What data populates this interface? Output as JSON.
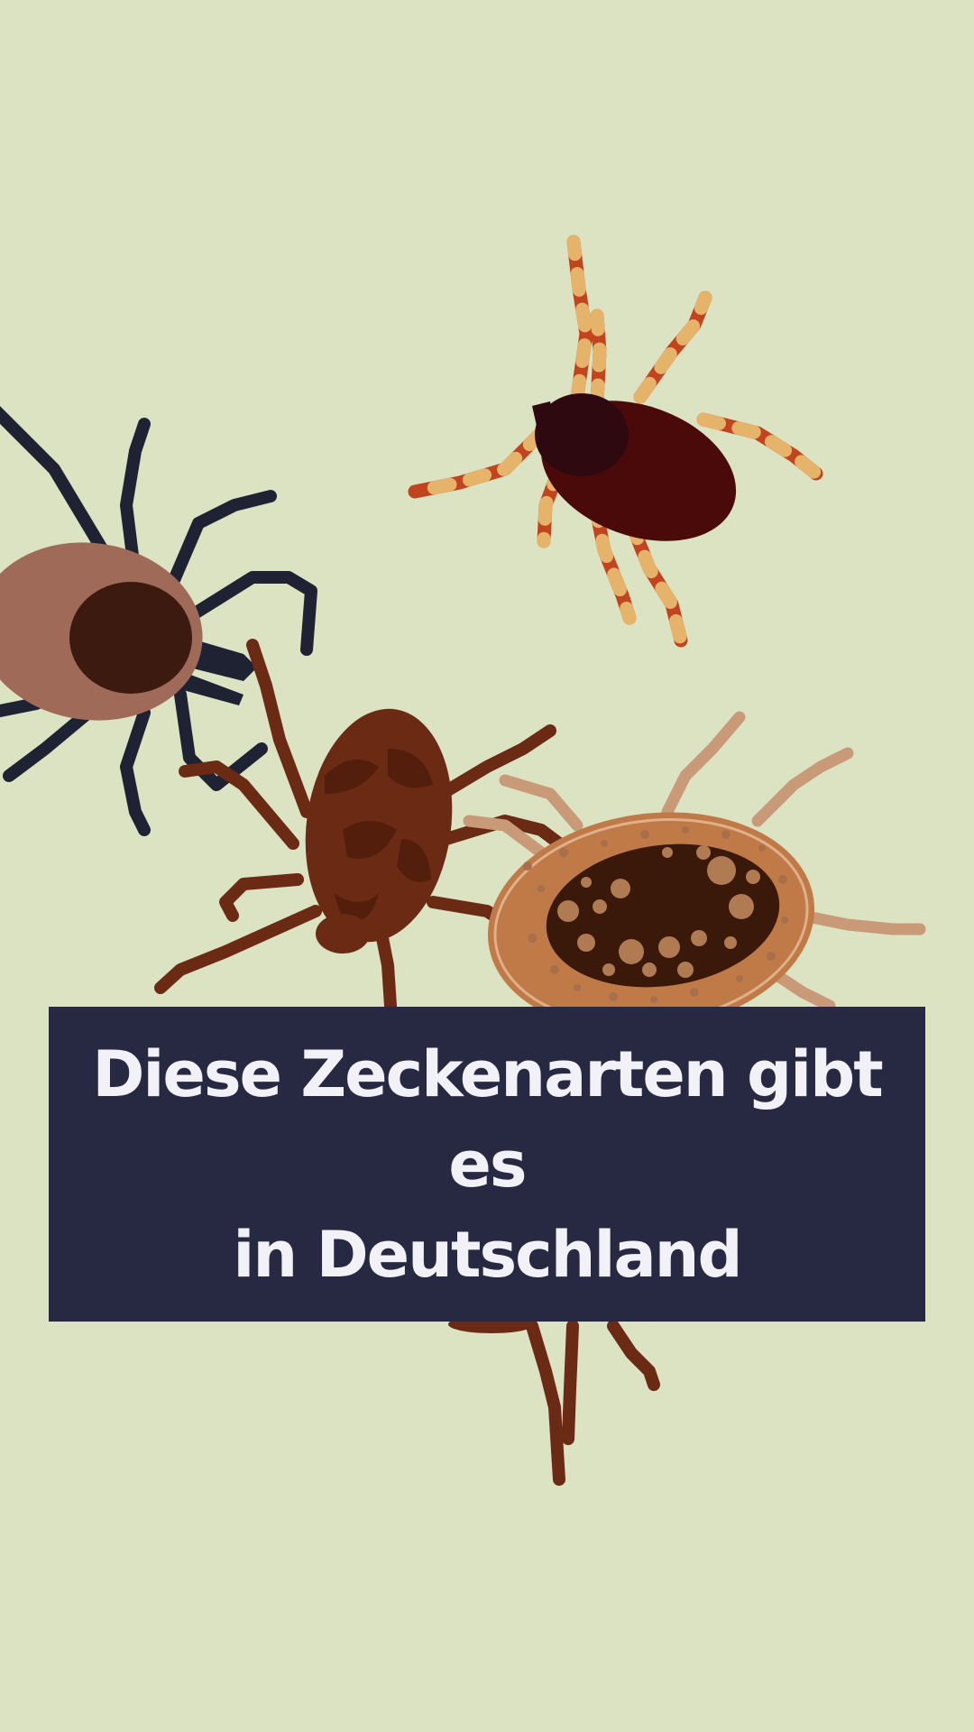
{
  "title": {
    "line1": "Diese Zeckenarten gibt es",
    "line2": "in Deutschland"
  },
  "colors": {
    "background": "#dbe3c3",
    "banner": "#272842",
    "banner_text": "#f2f1f7",
    "tick_black_legs": "#1e2233",
    "tick_black_shield": "#3d1a10",
    "tick_black_body": "#a06a58",
    "tick_red_body": "#4a0a0a",
    "tick_red_leg_a": "#c2441f",
    "tick_red_leg_b": "#e6b36b",
    "tick_brown": "#6b2a14",
    "tick_tan_body": "#c07a48",
    "tick_tan_core": "#3a180a",
    "tick_tan_legs": "#c99a78"
  },
  "illustration": {
    "items": [
      "black-legged-tick",
      "red-striped-tick",
      "brown-tick",
      "tan-spotted-tick"
    ]
  }
}
